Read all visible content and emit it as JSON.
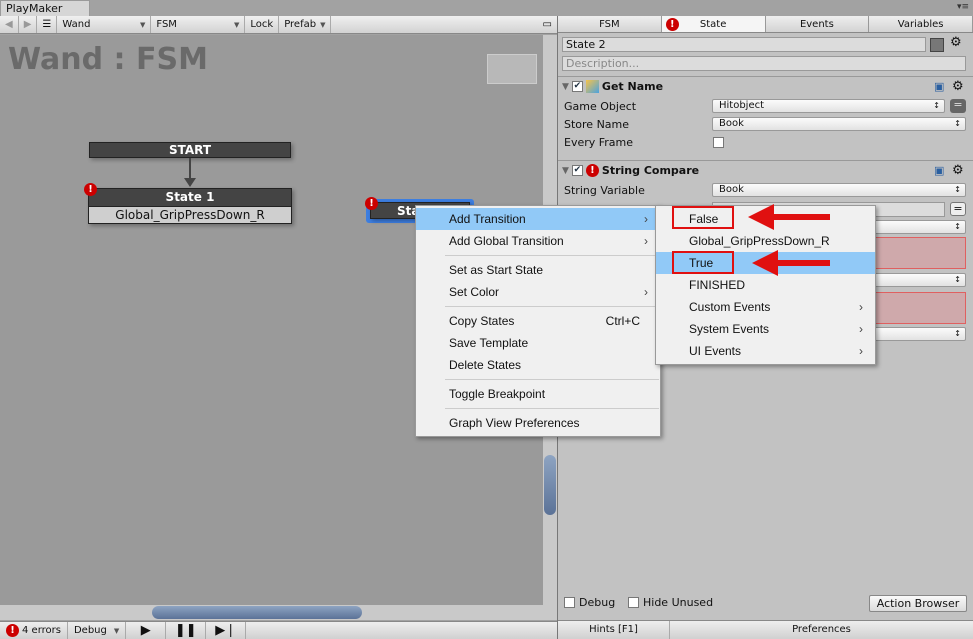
{
  "window": {
    "title": "PlayMaker"
  },
  "toolbar": {
    "game_object": "Wand",
    "fsm": "FSM",
    "lock": "Lock",
    "prefab": "Prefab"
  },
  "graph": {
    "title": "Wand : FSM",
    "start_label": "START",
    "state1": {
      "name": "State 1",
      "transition": "Global_GripPressDown_R"
    },
    "state2": {
      "name": "State 2",
      "visible_text": "Sta"
    }
  },
  "context_menu": {
    "items": [
      {
        "label": "Add Transition",
        "submenu": true
      },
      {
        "label": "Add Global Transition",
        "submenu": true
      },
      {
        "label": "Set as Start State"
      },
      {
        "label": "Set Color",
        "submenu": true
      },
      {
        "label": "Copy States",
        "shortcut": "Ctrl+C"
      },
      {
        "label": "Save Template"
      },
      {
        "label": "Delete States"
      },
      {
        "label": "Toggle Breakpoint"
      },
      {
        "label": "Graph View Preferences"
      }
    ]
  },
  "submenu": {
    "items": [
      {
        "label": "False"
      },
      {
        "label": "Global_GripPressDown_R"
      },
      {
        "label": "True"
      },
      {
        "label": "FINISHED"
      },
      {
        "label": "Custom Events",
        "submenu": true
      },
      {
        "label": "System Events",
        "submenu": true
      },
      {
        "label": "UI Events",
        "submenu": true
      }
    ]
  },
  "bottom_bar": {
    "errors": "4 errors",
    "mode": "Debug"
  },
  "inspector": {
    "tabs": [
      "FSM",
      "State",
      "Events",
      "Variables"
    ],
    "state_name": "State 2",
    "description_placeholder": "Description...",
    "actions": [
      {
        "title": "Get Name",
        "fields": [
          {
            "label": "Game Object",
            "value": "Hitobject"
          },
          {
            "label": "Store Name",
            "value": "Book"
          },
          {
            "label": "Every Frame",
            "value": ""
          }
        ]
      },
      {
        "title": "String Compare",
        "fields": [
          {
            "label": "String Variable",
            "value": "Book"
          }
        ]
      }
    ],
    "debug_label": "Debug",
    "hide_unused_label": "Hide Unused",
    "action_browser": "Action Browser",
    "hints": "Hints [F1]",
    "preferences": "Preferences"
  },
  "colors": {
    "highlight": "#91c9f7",
    "error": "#cc0000",
    "annotation": "#e01010",
    "selection": "#3d7ee0"
  }
}
